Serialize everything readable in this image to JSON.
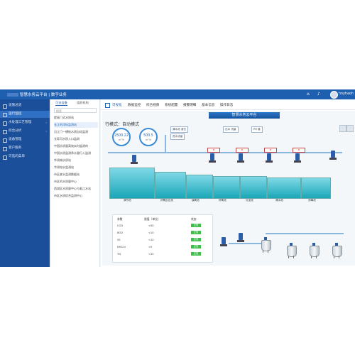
{
  "header": {
    "title": "智慧水务云平台 | 数字业务",
    "user": "hnyhaoh",
    "colors": {
      "bar": "#1f5fb0",
      "accent": "#3cc04a"
    }
  },
  "sidebar": {
    "items": [
      {
        "label": "设施总览",
        "icon": "grid-icon"
      },
      {
        "label": "运行监控",
        "icon": "monitor-icon",
        "active": true
      },
      {
        "label": "水处理工艺管理",
        "icon": "gear-icon"
      },
      {
        "label": "综合分析",
        "icon": "chart-icon"
      },
      {
        "label": "设备管理",
        "icon": "device-icon"
      },
      {
        "label": "客户服务",
        "icon": "user-icon"
      },
      {
        "label": "可选的菜单",
        "icon": "list-icon"
      }
    ]
  },
  "subnav": {
    "tabs": [
      "可选设备",
      "组织机构"
    ],
    "search_placeholder": "搜索",
    "rows": [
      "提高门式水质站",
      "长江的浮标监测站",
      "沿江门一横街水质自动监测",
      "长寿河水质入口监测",
      "中国水质量高效实时监测的",
      "中国水质监测净水量行入监测",
      "华润城水质站",
      "华润电水监测站",
      "市区废水监测数据站",
      "市区的水质量中心",
      "西湖区水质量中心与临江水站",
      "市区水质综合监测中心"
    ]
  },
  "menubar": {
    "items": [
      "可视化",
      "数据监控",
      "综合视频",
      "系统配置",
      "报警明细",
      "基本信息",
      "操作日志"
    ]
  },
  "scada": {
    "banner": "智慧水务云平台",
    "mode": "行模式：自动模式",
    "gauges": [
      {
        "value": "2500.22",
        "unit": "m³/h"
      },
      {
        "value": "500.5",
        "unit": "m³/h"
      }
    ],
    "tags": [
      "清水池 液位",
      "进水流量",
      "出水 流量",
      "PH 值"
    ],
    "tanks": [
      "调节池",
      "厌氧反应池",
      "缺氧池",
      "好氧池",
      "沉淀池",
      "清水池",
      "消毒池"
    ],
    "table": {
      "headers": [
        "参数",
        "限值（单位）",
        "状态"
      ],
      "rows": [
        {
          "name": "COD",
          "limit": "<50",
          "status": "正常"
        },
        {
          "name": "BOD",
          "limit": "<10",
          "status": "正常"
        },
        {
          "name": "SS",
          "limit": "<10",
          "status": "正常"
        },
        {
          "name": "NH3-N",
          "limit": "<5",
          "status": "正常"
        },
        {
          "name": "TN",
          "limit": "<15",
          "status": "正常"
        }
      ]
    }
  }
}
